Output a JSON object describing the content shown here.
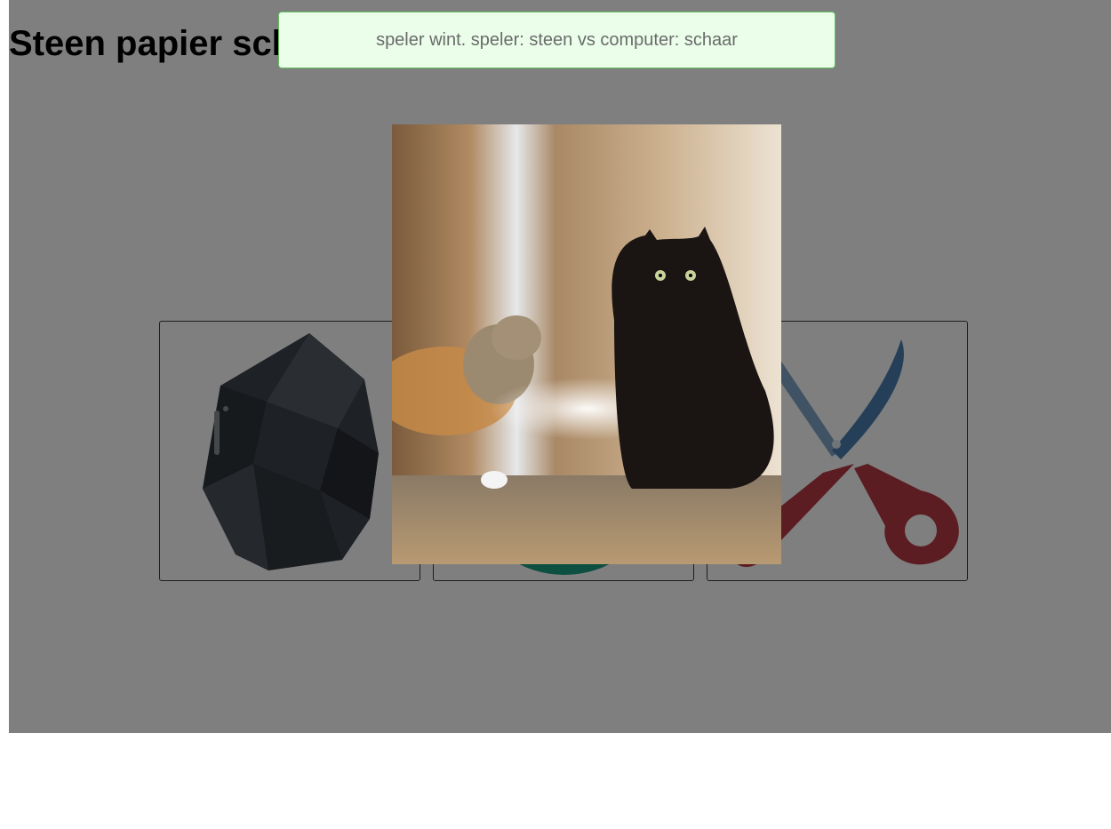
{
  "page": {
    "title": "Steen papier schaar"
  },
  "choices": [
    {
      "name": "steen",
      "icon": "rock-icon"
    },
    {
      "name": "papier",
      "icon": "paper-icon"
    },
    {
      "name": "schaar",
      "icon": "scissors-icon"
    }
  ],
  "result": {
    "message": "speler wint. speler: steen vs computer: schaar",
    "winner": "speler",
    "player_choice": "steen",
    "computer_choice": "schaar"
  },
  "popup_image": {
    "subject": "cats-gif",
    "description_icon": "cat-photo"
  },
  "colors": {
    "overlay": "rgba(0,0,0,0.5)",
    "toast_background": "#eafeea",
    "toast_border": "#62c262",
    "toast_text": "#6b6b6b",
    "rock": "#3d434b",
    "paper": "#1b9e83",
    "scissors_blade": "#4a7fb0",
    "scissors_handle": "#b83a44"
  }
}
